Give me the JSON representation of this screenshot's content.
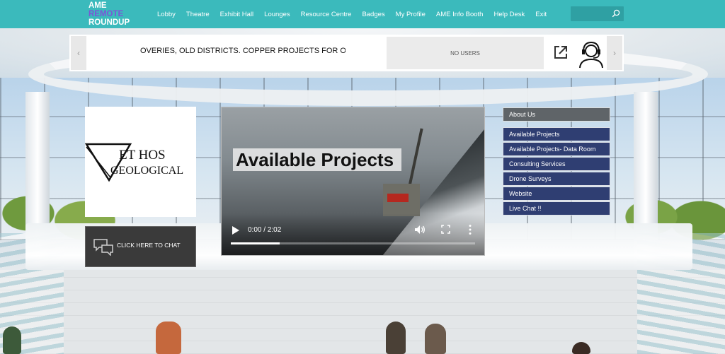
{
  "logo": {
    "line1": "AME",
    "line2": "REMOTE",
    "line3": "ROUNDUP"
  },
  "nav": {
    "items": [
      {
        "label": "Lobby"
      },
      {
        "label": "Theatre"
      },
      {
        "label": "Exhibit Hall"
      },
      {
        "label": "Lounges"
      },
      {
        "label": "Resource Centre"
      },
      {
        "label": "Badges"
      },
      {
        "label": "My Profile"
      },
      {
        "label": "AME Info Booth"
      },
      {
        "label": "Help Desk"
      },
      {
        "label": "Exit"
      }
    ],
    "search_value": ""
  },
  "banner": {
    "ticker": "OVERIES, OLD DISTRICTS. COPPER PROJECTS FOR OP",
    "users_label": "NO USERS",
    "prev_arrow": "‹",
    "next_arrow": "›"
  },
  "company": {
    "name_top": "ET HOS",
    "name_bottom": "GEOLOGICAL"
  },
  "chat": {
    "label": "CLICK HERE TO CHAT"
  },
  "video": {
    "title": "Available Projects",
    "time": "0:00 / 2:02",
    "progress": 0.2
  },
  "side_menu": {
    "header": "About Us",
    "items": [
      {
        "label": "Available Projects"
      },
      {
        "label": "Available Projects- Data Room"
      },
      {
        "label": "Consulting Services"
      },
      {
        "label": "Drone Surveys"
      },
      {
        "label": "Website"
      },
      {
        "label": "Live Chat !!"
      }
    ]
  },
  "colors": {
    "nav_bg": "#3bbabc",
    "menu_bg": "#2f3e72",
    "header_bg": "#5f6468",
    "logo_accent": "#7b56d6"
  }
}
